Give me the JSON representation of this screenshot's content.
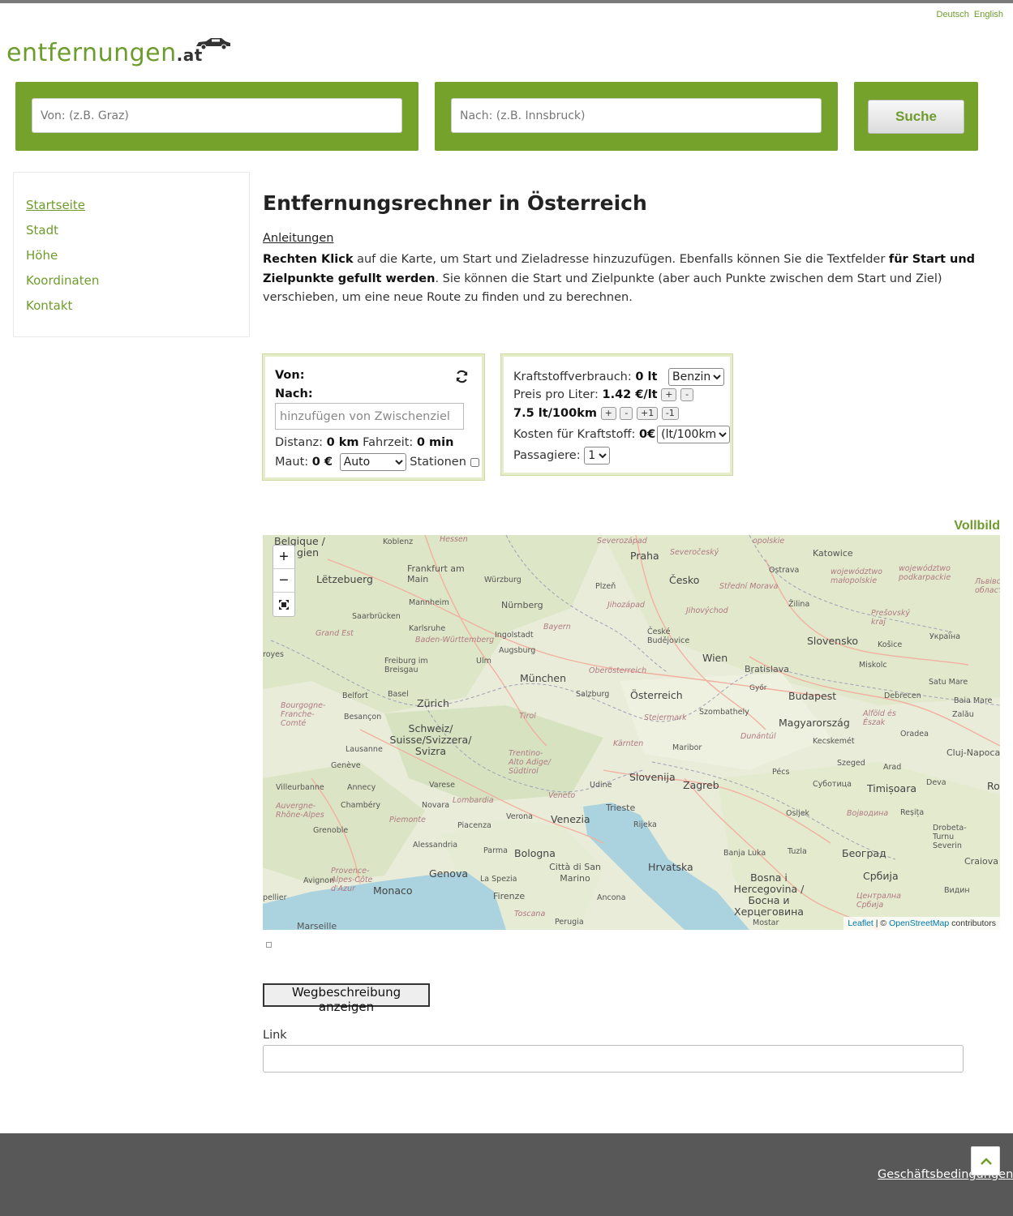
{
  "language_links": [
    "Deutsch",
    "English"
  ],
  "logo": {
    "name": "entfernungen",
    "tld": ".at"
  },
  "search": {
    "from_placeholder": "Von: (z.B. Graz)",
    "to_placeholder": "Nach: (z.B. Innsbruck)",
    "button_label": "Suche"
  },
  "sidebar": {
    "items": [
      {
        "label": "Startseite"
      },
      {
        "label": "Stadt"
      },
      {
        "label": "Höhe"
      },
      {
        "label": "Koordinaten"
      },
      {
        "label": "Kontakt"
      }
    ]
  },
  "main": {
    "title": "Entfernungsrechner in Österreich",
    "instructions_link": "Anleitungen",
    "intro": {
      "b1": "Rechten Klick",
      "t1": " auf die Karte, um Start und Zieladresse hinzuzufügen. Ebenfalls können Sie die Textfelder ",
      "b2": "für Start und Zielpunkte gefullt werden",
      "t2": ". Sie können die Start und Zielpunkte (aber auch Punkte zwischen dem Start und Ziel) verschieben, um eine neue Route zu finden und zu berechnen."
    }
  },
  "route_panel": {
    "from_label": "Von:",
    "to_label": "Nach:",
    "waypoint_placeholder": "hinzufügen von Zwischenziel",
    "distance_label": "Distanz:",
    "distance_value": "0 km",
    "time_label": "Fahrzeit:",
    "time_value": "0 min",
    "toll_label": "Maut:",
    "toll_value": "0 €",
    "vehicle_selected": "Auto",
    "stations_label": "Stationen"
  },
  "fuel_panel": {
    "consumption_label": "Kraftstoffverbrauch:",
    "consumption_value": "0 lt",
    "fuel_type": "Benzin",
    "price_label": "Preis pro Liter:",
    "price_value": "1.42 €/lt",
    "price_plus": "+",
    "price_minus": "-",
    "rate_value": "7.5 lt/100km",
    "rate_plus": "+",
    "rate_minus": "-",
    "rate_plus1": "+1",
    "rate_minus1": "-1",
    "cost_label": "Kosten für Kraftstoff:",
    "cost_value": "0€",
    "cost_unit_selected": "(lt/100km)",
    "passengers_label": "Passagiere:",
    "passengers_selected": "1"
  },
  "map": {
    "fullscreen_label": "Vollbild",
    "zoom_in": "+",
    "zoom_out": "−",
    "attribution_leaflet": "Leaflet",
    "attribution_sep": " | © ",
    "attribution_osm": "OpenStreetMap",
    "attribution_tail": " contributors",
    "labels": {
      "belgique": "Belgique /",
      "gien": "gien",
      "koblenz": "Koblenz",
      "hessen": "Hessen",
      "praha": "Praha",
      "severocesky": "Severočeský",
      "severozapad": "Severozápad",
      "opolskie": "opolskie",
      "katowice": "Katowice",
      "ostrava": "Ostrava",
      "wojewodztwo1": "województwo małopolskie",
      "wojewodztwo2": "województwo podkarpackie",
      "lvivska": "Львівськ област",
      "frankfurt": "Frankfurt am Main",
      "wurzburg": "Würzburg",
      "letzebuerg": "Lëtzebuerg",
      "plzen": "Plzeň",
      "cesko": "Česko",
      "stredni_morava": "Střední Morava",
      "mannheim": "Mannheim",
      "nurnberg": "Nürnberg",
      "jihozapad": "Jihozápad",
      "jihovychod": "Jihovýchod",
      "zilina": "Žilina",
      "presovsky": "Prešovský kraj",
      "saarbrucken": "Saarbrücken",
      "karlsruhe": "Karlsruhe",
      "bayern": "Bayern",
      "ceske_budejovice": "České Budějovice",
      "grand_est": "Grand Est",
      "baden": "Baden-Württemberg",
      "ingolstadt": "Ingolstadt",
      "augsburg": "Augsburg",
      "slovensko": "Slovensko",
      "kosice": "Košice",
      "ukraine": "Украї́на",
      "royes": "royes",
      "freiburg": "Freiburg im Breisgau",
      "ulm": "Ulm",
      "oberosterreich": "Oberösterreich",
      "wien": "Wien",
      "bratislava": "Bratislava",
      "miskolc": "Miskolc",
      "satu_mare": "Satu Mare",
      "munchen": "München",
      "belfort": "Belfort",
      "basel": "Basel",
      "salzburg": "Salzburg",
      "osterreich": "Österreich",
      "gyor": "Győr",
      "budapest": "Budapest",
      "debrecen": "Debrecen",
      "baia_mare": "Baia Mare",
      "bourgogne": "Bourgogne-Franche-Comté",
      "zurich": "Zürich",
      "besancon": "Besançon",
      "tirol": "Tirol",
      "steiermark": "Steiermark",
      "szombathely": "Szombathely",
      "zalau": "Zalău",
      "magyarorszag": "Magyarország",
      "alfold": "Alföld és Észak",
      "schweiz": "Schweiz/ Suisse/Svizzera/ Svizra",
      "dunantul": "Dunántúl",
      "oradea": "Oradea",
      "kecskemet": "Kecskemét",
      "lausanne": "Lausanne",
      "trentino": "Trentino-Alto Adige/ Südtirol",
      "karnten": "Kärnten",
      "maribor": "Maribor",
      "cluj": "Cluj-Napoca",
      "geneve": "Genève",
      "szeged": "Szeged",
      "arad": "Arad",
      "slovenija": "Slovenija",
      "zagreb": "Zagreb",
      "pecs": "Pécs",
      "villeurbanne": "Villeurbanne",
      "annecy": "Annecy",
      "varese": "Varese",
      "udine": "Udine",
      "subotica": "Суботица",
      "timisoara": "Timișoara",
      "deva": "Deva",
      "rom": "Rom",
      "auvergne": "Auvergne-Rhône-Alpes",
      "chambery": "Chambéry",
      "lombardia": "Lombardia",
      "veneto": "Veneto",
      "trieste": "Trieste",
      "novara": "Novara",
      "osijek": "Osijek",
      "vojvodina": "Војводина",
      "resita": "Reșița",
      "piemonte": "Piemonte",
      "verona": "Verona",
      "venezia": "Venezia",
      "rijeka": "Rijeka",
      "grenoble": "Grenoble",
      "piacenza": "Piacenza",
      "drobeta": "Drobeta-Turnu Severin",
      "alessandria": "Alessandria",
      "parma": "Parma",
      "bologna": "Bologna",
      "banja_luka": "Banja Luka",
      "tuzla": "Tuzla",
      "beograd": "Београд",
      "craiova": "Craiova",
      "provence": "Provence-Alpes-Côte d'Azur",
      "genova": "Genova",
      "citta": "Città di San Marino",
      "hrvatska": "Hrvatska",
      "srbija": "Србија",
      "avignon": "Avignon",
      "la_spezia": "La Spezia",
      "bosna": "Bosna i Hercegovina / Босна и Херцеговина",
      "vidin": "Видин",
      "monaco": "Monaco",
      "pellier": "pellier",
      "firenze": "Firenze",
      "ancona": "Ancona",
      "centralna_srbija": "Централна Србија",
      "toscana": "Toscana",
      "marseille": "Marseille",
      "perugia": "Perugia",
      "mostar": "Mostar"
    }
  },
  "directions_button": "Wegbeschreibung anzeigen",
  "link_label": "Link",
  "footer": {
    "terms_link": "Geschäftsbedingungen"
  },
  "colors": {
    "brand_green": "#74a22a",
    "link_green": "#6e9c2c",
    "footer_bg": "#585858"
  }
}
